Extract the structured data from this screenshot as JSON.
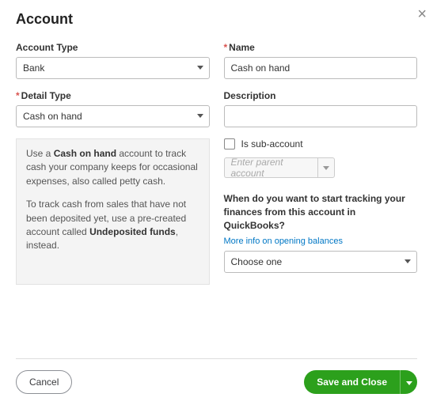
{
  "dialog": {
    "title": "Account"
  },
  "left": {
    "account_type_label": "Account Type",
    "account_type_value": "Bank",
    "detail_type_label": "Detail Type",
    "detail_type_value": "Cash on hand",
    "help_para1_pre": "Use a ",
    "help_para1_bold": "Cash on hand",
    "help_para1_post": " account to track cash your company keeps for occasional expenses, also called petty cash.",
    "help_para2_pre": "To track cash from sales that have not been deposited yet, use a pre-created account called ",
    "help_para2_bold": "Undeposited funds",
    "help_para2_post": ", instead."
  },
  "right": {
    "name_label": "Name",
    "name_value": "Cash on hand",
    "description_label": "Description",
    "description_value": "",
    "sub_account_label": "Is sub-account",
    "parent_placeholder": "Enter parent account",
    "tracking_question": "When do you want to start tracking your finances from this account in QuickBooks?",
    "info_link": "More info on opening balances",
    "tracking_select_value": "Choose one"
  },
  "footer": {
    "cancel": "Cancel",
    "save": "Save and Close"
  }
}
